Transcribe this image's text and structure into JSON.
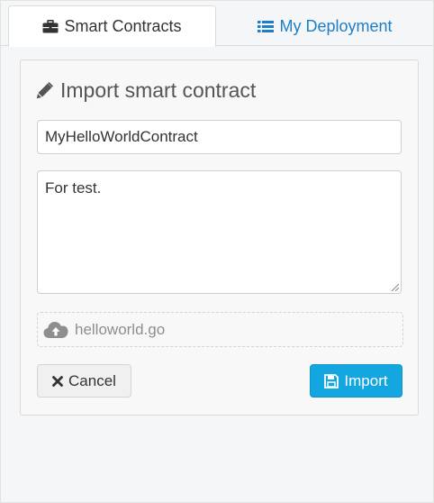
{
  "tabs": {
    "smart_contracts": {
      "label": "Smart Contracts",
      "icon": "briefcase-icon"
    },
    "my_deployment": {
      "label": "My Deployment",
      "icon": "list-icon"
    }
  },
  "panel": {
    "title": "Import smart contract",
    "title_icon": "pencil-icon",
    "name_value": "MyHelloWorldContract",
    "description_value": "For test.",
    "file_name": "helloworld.go",
    "upload_icon": "cloud-upload-icon"
  },
  "actions": {
    "cancel_label": "Cancel",
    "cancel_icon": "close-icon",
    "import_label": "Import",
    "import_icon": "save-icon"
  },
  "colors": {
    "link": "#1e7fc6",
    "primary_button": "#14a6e0",
    "muted_text": "#8e8e8e"
  }
}
